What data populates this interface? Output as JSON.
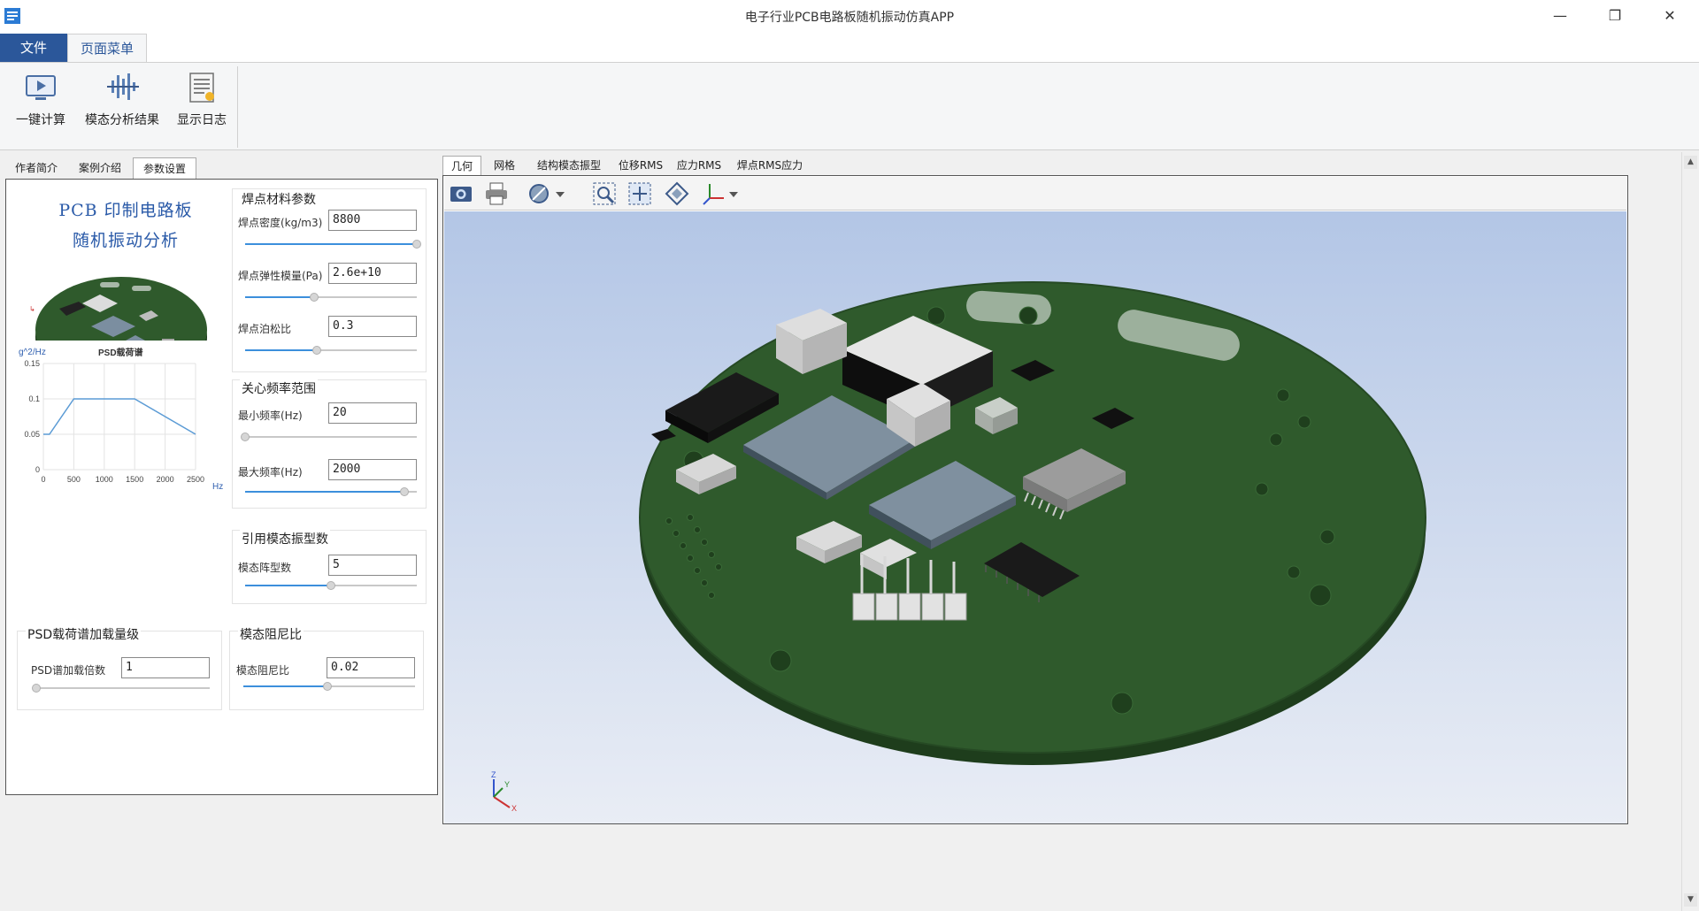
{
  "window": {
    "title": "电子行业PCB电路板随机振动仿真APP",
    "minimize": "—",
    "restore": "❐",
    "close": "✕"
  },
  "ribbon_tabs": {
    "file": "文件",
    "page_menu": "页面菜单"
  },
  "ribbon": {
    "compute": "一键计算",
    "modal_results": "模态分析结果",
    "show_log": "显示日志"
  },
  "left_tabs": [
    "作者简介",
    "案例介绍",
    "参数设置"
  ],
  "brand": {
    "line1": "PCB 印制电路板",
    "line2": "随机振动分析"
  },
  "psd_chart": {
    "chart_data": {
      "type": "line",
      "title": "PSD载荷谱",
      "ylabel": "g^2/Hz",
      "xlabel": "Hz",
      "x": [
        0,
        100,
        500,
        1500,
        2500
      ],
      "y": [
        0.05,
        0.05,
        0.1,
        0.1,
        0.05
      ],
      "xlim": [
        0,
        2500
      ],
      "ylim": [
        0,
        0.15
      ],
      "xticks": [
        "0",
        "500",
        "1000",
        "1500",
        "2000",
        "2500"
      ],
      "yticks": [
        "0",
        "0.05",
        "0.1",
        "0.15"
      ],
      "grid": true
    }
  },
  "solder_group": {
    "title": "焊点材料参数",
    "density_label": "焊点密度(kg/m3)",
    "density_value": "8800",
    "density_level": 1.0,
    "modulus_label": "焊点弹性模量(Pa)",
    "modulus_value": "2.6e+10",
    "modulus_level": 0.4,
    "poisson_label": "焊点泊松比",
    "poisson_value": "0.3",
    "poisson_level": 0.42
  },
  "freq_group": {
    "title": "关心频率范围",
    "min_label": "最小频率(Hz)",
    "min_value": "20",
    "min_level": 0.0,
    "max_label": "最大频率(Hz)",
    "max_value": "2000",
    "max_level": 0.93
  },
  "modes_group": {
    "title": "引用模态振型数",
    "label": "模态阵型数",
    "value": "5",
    "level": 0.5
  },
  "psd_group": {
    "title": "PSD载荷谱加载量级",
    "label": "PSD谱加载倍数",
    "value": "1",
    "level": 0.0
  },
  "damping_group": {
    "title": "模态阻尼比",
    "label": "模态阻尼比",
    "value": "0.02",
    "level": 0.49
  },
  "viewer_tabs": [
    "几何",
    "网格",
    "结构模态振型",
    "位移RMS",
    "应力RMS",
    "焊点RMS应力"
  ],
  "axes": {
    "z": "Z",
    "y": "Y",
    "x": "X"
  },
  "colors": {
    "accent": "#2b579a",
    "board": "#2f5a2c",
    "board_edge": "#1e3d1c",
    "scene_top": "#b3c6e6",
    "scene_bottom": "#e9edf5"
  },
  "icons": [
    "screenshot-icon",
    "print-icon",
    "display-mode-icon",
    "zoom-window-icon",
    "fit-all-icon",
    "iso-view-icon",
    "axis-view-icon"
  ]
}
